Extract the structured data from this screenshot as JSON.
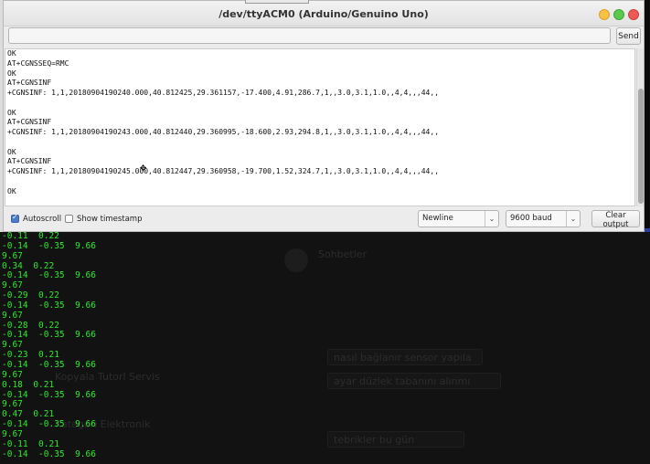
{
  "window": {
    "title": "/dev/ttyACM0 (Arduino/Genuino Uno)",
    "send_label": "Send",
    "send_input_value": ""
  },
  "output_lines": [
    "OK",
    "AT+CGNSSEQ=RMC",
    "OK",
    "AT+CGNSINF",
    "+CGNSINF: 1,1,20180904190240.000,40.812425,29.361157,-17.400,4.91,286.7,1,,3.0,3.1,1.0,,4,4,,,44,,",
    "",
    "OK",
    "AT+CGNSINF",
    "+CGNSINF: 1,1,20180904190243.000,40.812440,29.360995,-18.600,2.93,294.8,1,,3.0,3.1,1.0,,4,4,,,44,,",
    "",
    "OK",
    "AT+CGNSINF",
    "+CGNSINF: 1,1,20180904190245.000,40.812447,29.360958,-19.700,1.52,324.7,1,,3.0,3.1,1.0,,4,4,,,44,,",
    "",
    "OK"
  ],
  "bottom": {
    "autoscroll_label": "Autoscroll",
    "autoscroll_checked": true,
    "timestamp_label": "Show timestamp",
    "timestamp_checked": false,
    "line_ending": "Newline",
    "baud": "9600 baud",
    "clear_label": "Clear output"
  },
  "terminal_lines": [
    "-0.11  0.22",
    "-0.14  -0.35  9.66",
    "9.67",
    "0.34  0.22",
    "-0.14  -0.35  9.66",
    "9.67",
    "-0.29  0.22",
    "-0.14  -0.35  9.66",
    "9.67",
    "-0.28  0.22",
    "-0.14  -0.35  9.66",
    "9.67",
    "-0.23  0.21",
    "-0.14  -0.35  9.66",
    "9.67",
    "0.18  0.21",
    "-0.14  -0.35  9.66",
    "9.67",
    "0.47  0.21",
    "-0.14  -0.35  9.66",
    "9.67",
    "-0.11  0.21",
    "-0.14  -0.35  9.66"
  ],
  "background_app": {
    "ghost_texts": [
      "Sohbetler",
      "Kopyala Tutorl Servis",
      "Kategori Elektronik",
      "nasıl bağlanır sensor yapıla",
      "ayar düzlek tabanını alınmı",
      "tebrikler bu gün"
    ]
  },
  "colors": {
    "terminal_text": "#2ee82e",
    "terminal_bg": "#0b0b0b",
    "close": "#ec5a55",
    "minimize": "#f6c244",
    "maximize": "#5bc94a"
  }
}
